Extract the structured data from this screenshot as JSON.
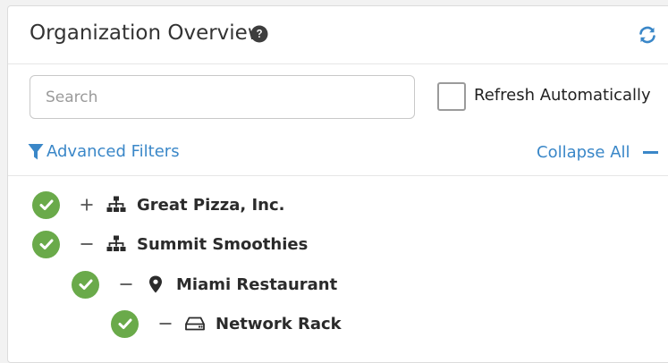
{
  "header": {
    "title": "Organization Overview"
  },
  "search": {
    "placeholder": "Search",
    "value": ""
  },
  "auto_refresh": {
    "label": "Refresh Automatically",
    "checked": false
  },
  "filters": {
    "advanced_label": "Advanced Filters",
    "collapse_label": "Collapse All"
  },
  "colors": {
    "accent": "#3a87c8",
    "status_ok": "#6aaa4a"
  },
  "tree": [
    {
      "label": "Great Pizza, Inc.",
      "toggle": "+",
      "icon": "sitemap-icon",
      "status": "ok",
      "depth": 0
    },
    {
      "label": "Summit Smoothies",
      "toggle": "−",
      "icon": "sitemap-icon",
      "status": "ok",
      "depth": 0
    },
    {
      "label": "Miami Restaurant",
      "toggle": "−",
      "icon": "map-marker-icon",
      "status": "ok",
      "depth": 1
    },
    {
      "label": "Network Rack",
      "toggle": "−",
      "icon": "hard-drive-icon",
      "status": "ok",
      "depth": 2
    }
  ]
}
